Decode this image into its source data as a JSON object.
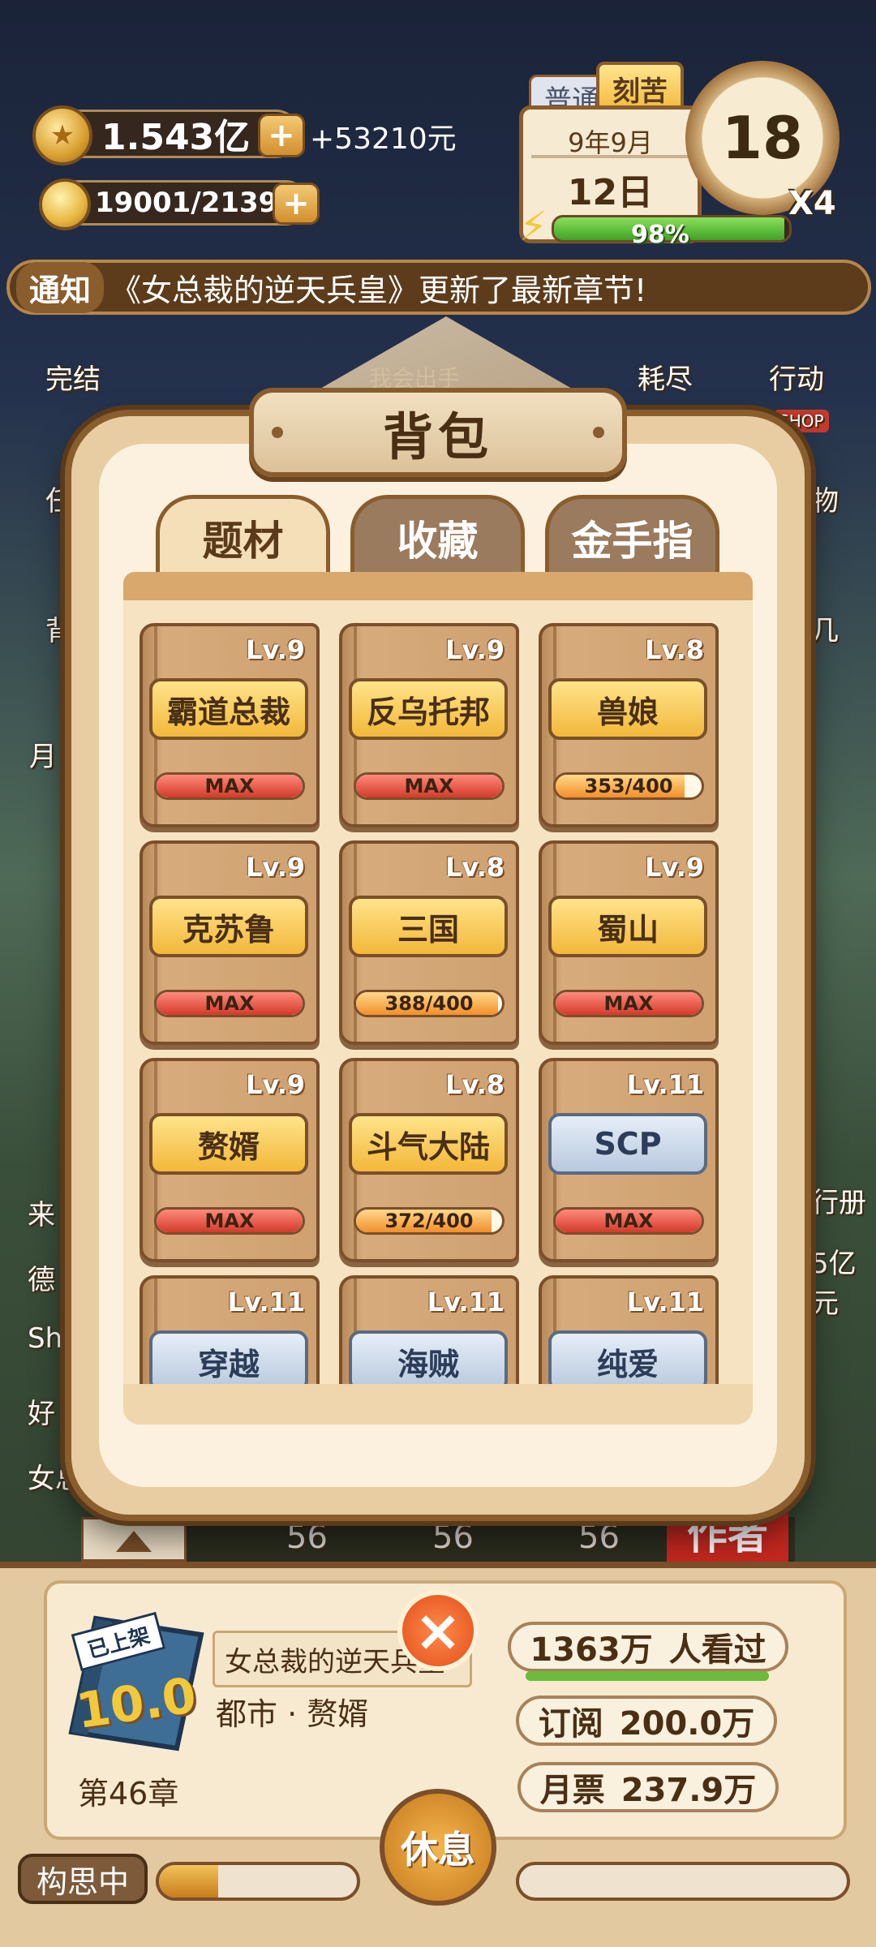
{
  "hud": {
    "coins": "1.543亿",
    "income": "+53210元",
    "ideas": "19001/21399",
    "tag_normal": "普通",
    "tag_hard": "刻苦",
    "date_line1": "9年9月",
    "date_line2": "12日",
    "clock_value": "18",
    "multiplier": "X4",
    "energy_percent_text": "98%",
    "energy_percent": 98
  },
  "notice": {
    "tag": "通知",
    "text": "《女总裁的逆天兵皇》更新了最新章节!"
  },
  "background": {
    "left_labels": [
      "完结",
      "任",
      "背",
      "月",
      "来",
      "德",
      "Sh",
      "好",
      "女总"
    ],
    "right_labels": [
      "耗尽",
      "行动",
      "SHOP",
      "物",
      "几",
      "行册",
      "5亿元"
    ],
    "house_sign": "我会出手",
    "counts": [
      "56",
      "56",
      "56"
    ],
    "author_badge": "作者"
  },
  "modal": {
    "title": "背包",
    "tabs": [
      {
        "label": "题材",
        "active": true
      },
      {
        "label": "收藏",
        "active": false
      },
      {
        "label": "金手指",
        "active": false
      }
    ],
    "items": [
      {
        "level": "Lv.9",
        "name": "霸道总裁",
        "style": "gold",
        "progress_text": "MAX",
        "progress": 1.0
      },
      {
        "level": "Lv.9",
        "name": "反乌托邦",
        "style": "gold",
        "progress_text": "MAX",
        "progress": 1.0
      },
      {
        "level": "Lv.8",
        "name": "兽娘",
        "style": "gold",
        "progress_text": "353/400",
        "progress": 0.8825
      },
      {
        "level": "Lv.9",
        "name": "克苏鲁",
        "style": "gold",
        "progress_text": "MAX",
        "progress": 1.0
      },
      {
        "level": "Lv.8",
        "name": "三国",
        "style": "gold",
        "progress_text": "388/400",
        "progress": 0.97
      },
      {
        "level": "Lv.9",
        "name": "蜀山",
        "style": "gold",
        "progress_text": "MAX",
        "progress": 1.0
      },
      {
        "level": "Lv.9",
        "name": "赘婿",
        "style": "gold",
        "progress_text": "MAX",
        "progress": 1.0
      },
      {
        "level": "Lv.8",
        "name": "斗气大陆",
        "style": "gold",
        "progress_text": "372/400",
        "progress": 0.93
      },
      {
        "level": "Lv.11",
        "name": "SCP",
        "style": "blue",
        "progress_text": "MAX",
        "progress": 1.0
      },
      {
        "level": "Lv.11",
        "name": "穿越",
        "style": "blue",
        "progress_text": "",
        "progress": 0
      },
      {
        "level": "Lv.11",
        "name": "海贼",
        "style": "blue",
        "progress_text": "",
        "progress": 0
      },
      {
        "level": "Lv.11",
        "name": "纯爱",
        "style": "blue",
        "progress_text": "",
        "progress": 0
      }
    ]
  },
  "book_panel": {
    "book_badge": "已上架",
    "book_score": "10.0",
    "chapter": "第46章",
    "book_title": "女总裁的逆天兵皇",
    "genre": "都市 · 赘婿",
    "views_value": "1363万",
    "views_label": "人看过",
    "subs_label": "订阅",
    "subs_value": "200.0万",
    "tickets_label": "月票",
    "tickets_value": "237.9万",
    "status": "构思中",
    "rest_label": "休息",
    "left_progress": 0.3,
    "right_progress": 0.0
  },
  "colors": {
    "wood_dark": "#8a5d2d",
    "gold": "#f2b83a",
    "max_red": "#d33a2c",
    "progress_orange": "#f28f2a",
    "energy_green": "#3fa224"
  }
}
